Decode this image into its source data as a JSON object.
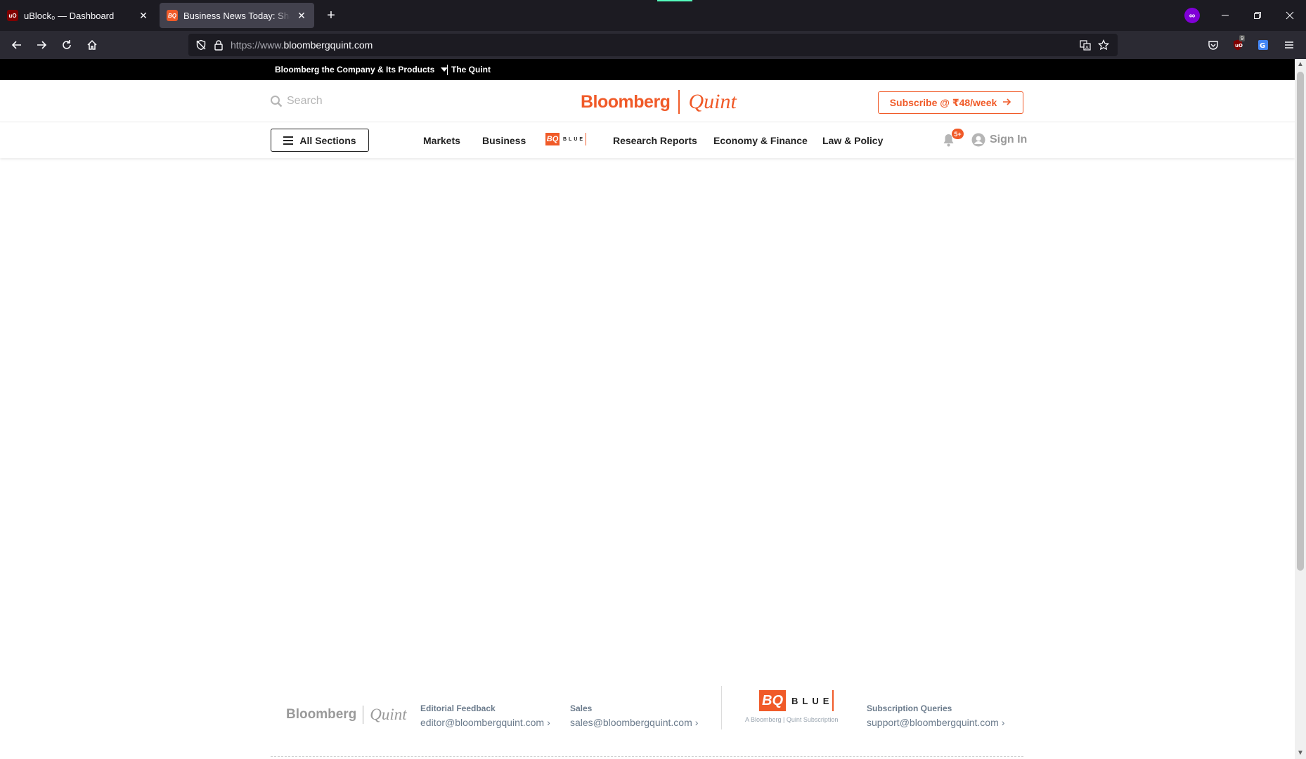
{
  "browser": {
    "tabs": [
      {
        "title": "uBlock₀ — Dashboard",
        "favicon_text": "uO",
        "favicon_color": "#800000",
        "active": false
      },
      {
        "title": "Business News Today: Share Ma",
        "favicon_text": "BQ",
        "favicon_color": "#f05a28",
        "active": true
      }
    ],
    "url_prefix": "https://www.",
    "url_host": "bloombergquint.com",
    "ublock_count": "9"
  },
  "site": {
    "top_strip": {
      "company_label": "Bloomberg the Company & Its Products",
      "quint_label": "The Quint"
    },
    "search_placeholder": "Search",
    "logo": {
      "bloomberg": "Bloomberg",
      "quint": "Quint"
    },
    "subscribe_label": "Subscribe @ ₹48/week",
    "all_sections_label": "All Sections",
    "nav": [
      {
        "label": "Markets"
      },
      {
        "label": "Business"
      },
      {
        "label": "Research Reports"
      },
      {
        "label": "Economy & Finance"
      },
      {
        "label": "Law & Policy"
      }
    ],
    "bq_blue": {
      "bq": "BQ",
      "blue": "BLUE"
    },
    "notif_badge": "5+",
    "signin_label": "Sign In",
    "footer": {
      "logo": {
        "bloomberg": "Bloomberg",
        "quint": "Quint"
      },
      "editorial": {
        "label": "Editorial Feedback",
        "email": "editor@bloombergquint.com"
      },
      "sales": {
        "label": "Sales",
        "email": "sales@bloombergquint.com"
      },
      "bq_blue": {
        "bq": "BQ",
        "blue": "BLUE",
        "sub": "A Bloomberg | Quint Subscription"
      },
      "subscription": {
        "label": "Subscription Queries",
        "email": "support@bloombergquint.com"
      }
    }
  },
  "colors": {
    "brand": "#f05a28",
    "chrome_dark": "#1c1b22",
    "chrome_toolbar": "#2b2a33"
  }
}
